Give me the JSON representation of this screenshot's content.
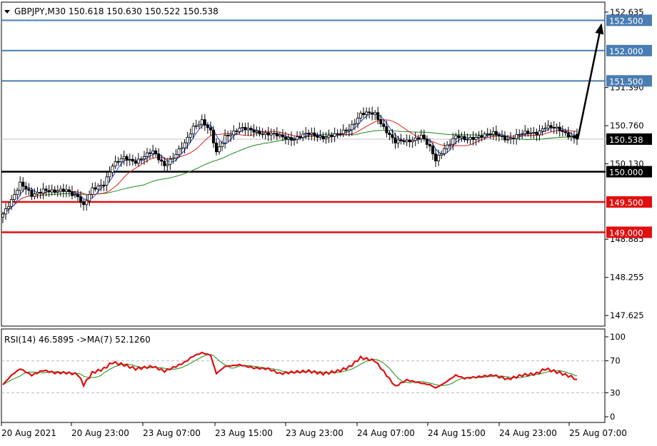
{
  "header": {
    "symbol_line": "GBPJPY,M30  150.618 150.630 150.522 150.538"
  },
  "rsi_header": {
    "label": "RSI(14) 46.5895  ->MA(7) 52.1260"
  },
  "colors": {
    "background": "#ffffff",
    "frame": "#000000",
    "bull_candle": "#ffffff",
    "bear_candle": "#000000",
    "ma_fast": "#1f3fd0",
    "ma_mid": "#e02020",
    "ma_slow": "#1a8a1a",
    "level_blue": "#4a7db1",
    "level_black": "#000000",
    "level_red": "#e01010",
    "rsi_line": "#e01010",
    "rsi_ma": "#1a8a1a",
    "bid_line": "#c0c0c0"
  },
  "chart_data": [
    {
      "type": "candlestick",
      "title": "GBPJPY,M30",
      "ohlc_current": {
        "open": 150.618,
        "high": 150.63,
        "low": 150.522,
        "close": 150.538
      },
      "ylim": [
        147.45,
        152.8
      ],
      "y_ticks": [
        152.635,
        151.39,
        150.76,
        150.13,
        148.885,
        148.255,
        147.625
      ],
      "x_ticks": [
        "20 Aug 2021",
        "20 Aug 23:00",
        "23 Aug 07:00",
        "23 Aug 15:00",
        "23 Aug 23:00",
        "24 Aug 07:00",
        "24 Aug 15:00",
        "24 Aug 23:00",
        "25 Aug 07:00"
      ],
      "levels": [
        {
          "value": 152.5,
          "label": "152.500",
          "style": "blue"
        },
        {
          "value": 152.0,
          "label": "152.000",
          "style": "blue"
        },
        {
          "value": 151.5,
          "label": "151.500",
          "style": "blue"
        },
        {
          "value": 150.0,
          "label": "150.000",
          "style": "black"
        },
        {
          "value": 149.5,
          "label": "149.500",
          "style": "red"
        },
        {
          "value": 149.0,
          "label": "149.000",
          "style": "red"
        }
      ],
      "bid": {
        "value": 150.538,
        "label": "150.538"
      },
      "projection": {
        "from": 150.538,
        "to": 152.5
      },
      "close_anchors": [
        [
          0,
          149.3
        ],
        [
          3,
          149.55
        ],
        [
          6,
          149.8
        ],
        [
          10,
          149.6
        ],
        [
          14,
          149.72
        ],
        [
          18,
          149.65
        ],
        [
          22,
          149.7
        ],
        [
          26,
          149.6
        ],
        [
          28,
          149.42
        ],
        [
          31,
          149.7
        ],
        [
          35,
          149.82
        ],
        [
          38,
          150.1
        ],
        [
          42,
          150.22
        ],
        [
          46,
          150.18
        ],
        [
          52,
          150.32
        ],
        [
          56,
          150.12
        ],
        [
          60,
          150.28
        ],
        [
          63,
          150.45
        ],
        [
          66,
          150.75
        ],
        [
          69,
          150.85
        ],
        [
          72,
          150.65
        ],
        [
          74,
          150.3
        ],
        [
          77,
          150.6
        ],
        [
          82,
          150.7
        ],
        [
          87,
          150.68
        ],
        [
          92,
          150.62
        ],
        [
          96,
          150.58
        ],
        [
          101,
          150.55
        ],
        [
          106,
          150.62
        ],
        [
          111,
          150.58
        ],
        [
          116,
          150.6
        ],
        [
          120,
          150.72
        ],
        [
          124,
          150.95
        ],
        [
          129,
          150.95
        ],
        [
          133,
          150.68
        ],
        [
          136,
          150.48
        ],
        [
          140,
          150.5
        ],
        [
          145,
          150.6
        ],
        [
          148,
          150.38
        ],
        [
          150,
          150.18
        ],
        [
          153,
          150.4
        ],
        [
          157,
          150.58
        ],
        [
          160,
          150.52
        ],
        [
          165,
          150.6
        ],
        [
          170,
          150.62
        ],
        [
          175,
          150.55
        ],
        [
          180,
          150.62
        ],
        [
          185,
          150.65
        ],
        [
          188,
          150.75
        ],
        [
          193,
          150.68
        ],
        [
          197,
          150.6
        ],
        [
          199,
          150.538
        ]
      ]
    },
    {
      "type": "line",
      "title": "RSI(14)",
      "ylim": [
        0,
        100
      ],
      "y_ticks": [
        100,
        70,
        30,
        0
      ],
      "levels": [
        70,
        30
      ],
      "series": [
        {
          "name": "RSI(14)",
          "last": 46.5895
        },
        {
          "name": "MA(7)",
          "last": 52.126
        }
      ],
      "rsi_anchors": [
        [
          0,
          40
        ],
        [
          3,
          52
        ],
        [
          6,
          60
        ],
        [
          10,
          52
        ],
        [
          14,
          58
        ],
        [
          18,
          55
        ],
        [
          22,
          55
        ],
        [
          26,
          53
        ],
        [
          28,
          40
        ],
        [
          31,
          55
        ],
        [
          35,
          60
        ],
        [
          38,
          68
        ],
        [
          42,
          65
        ],
        [
          46,
          60
        ],
        [
          52,
          63
        ],
        [
          56,
          57
        ],
        [
          60,
          63
        ],
        [
          63,
          68
        ],
        [
          66,
          76
        ],
        [
          69,
          80
        ],
        [
          72,
          77
        ],
        [
          74,
          54
        ],
        [
          77,
          63
        ],
        [
          82,
          65
        ],
        [
          87,
          61
        ],
        [
          92,
          60
        ],
        [
          96,
          54
        ],
        [
          101,
          56
        ],
        [
          106,
          57
        ],
        [
          111,
          54
        ],
        [
          116,
          57
        ],
        [
          120,
          62
        ],
        [
          124,
          74
        ],
        [
          129,
          70
        ],
        [
          133,
          52
        ],
        [
          136,
          38
        ],
        [
          140,
          46
        ],
        [
          145,
          42
        ],
        [
          148,
          40
        ],
        [
          150,
          36
        ],
        [
          153,
          42
        ],
        [
          157,
          52
        ],
        [
          160,
          48
        ],
        [
          165,
          50
        ],
        [
          170,
          52
        ],
        [
          175,
          47
        ],
        [
          180,
          52
        ],
        [
          185,
          54
        ],
        [
          188,
          60
        ],
        [
          193,
          55
        ],
        [
          197,
          50
        ],
        [
          199,
          46.5895
        ]
      ]
    }
  ]
}
